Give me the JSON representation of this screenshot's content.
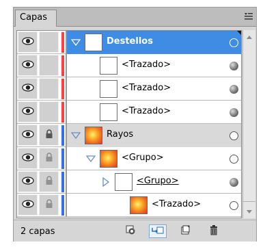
{
  "tabs": [
    {
      "label": "Capas"
    }
  ],
  "layers": [
    {
      "name": "Destellos",
      "level": 0,
      "expanded": true,
      "has_arrow": true,
      "thumb": "white",
      "target": "hollow",
      "selected": true,
      "locked": false,
      "color": "#ff4040"
    },
    {
      "name": "<Trazado>",
      "level": 1,
      "has_arrow": false,
      "thumb": "white",
      "target": "filled",
      "selected": false,
      "locked": false,
      "color": "#ff4040"
    },
    {
      "name": "<Trazado>",
      "level": 1,
      "has_arrow": false,
      "thumb": "white",
      "target": "filled",
      "selected": false,
      "locked": false,
      "color": "#ff4040"
    },
    {
      "name": "<Trazado>",
      "level": 1,
      "has_arrow": false,
      "thumb": "white",
      "target": "filled",
      "selected": false,
      "locked": false,
      "color": "#ff4040"
    },
    {
      "name": "Rayos",
      "level": 0,
      "expanded": true,
      "has_arrow": true,
      "thumb": "gradient",
      "target": "hollow",
      "selected": false,
      "locked": true,
      "color": "#3a6ee8"
    },
    {
      "name": "<Grupo>",
      "level": 1,
      "expanded": true,
      "has_arrow": true,
      "thumb": "gradient",
      "target": "hollow",
      "selected": false,
      "locked": true,
      "color": "#3a6ee8"
    },
    {
      "name": "<Grupo>",
      "level": 2,
      "expanded": false,
      "has_arrow": true,
      "thumb": "white",
      "target": "filled",
      "selected": false,
      "locked": true,
      "color": "#3a6ee8",
      "underlined": true
    },
    {
      "name": "<Trazado>",
      "level": 3,
      "has_arrow": false,
      "thumb": "gradient",
      "target": "hollow",
      "selected": false,
      "locked": true,
      "color": "#3a6ee8"
    }
  ],
  "footer": {
    "layer_count": "2 capas",
    "buttons": [
      {
        "icon": "make-clipping-mask-icon"
      },
      {
        "icon": "create-sublayer-icon"
      },
      {
        "icon": "new-layer-icon"
      },
      {
        "icon": "delete-layer-icon"
      }
    ]
  },
  "colors": {
    "selected": "#3e8ce4",
    "group_row": "#d9d9d9",
    "panel_bg": "#d6d6d6"
  }
}
